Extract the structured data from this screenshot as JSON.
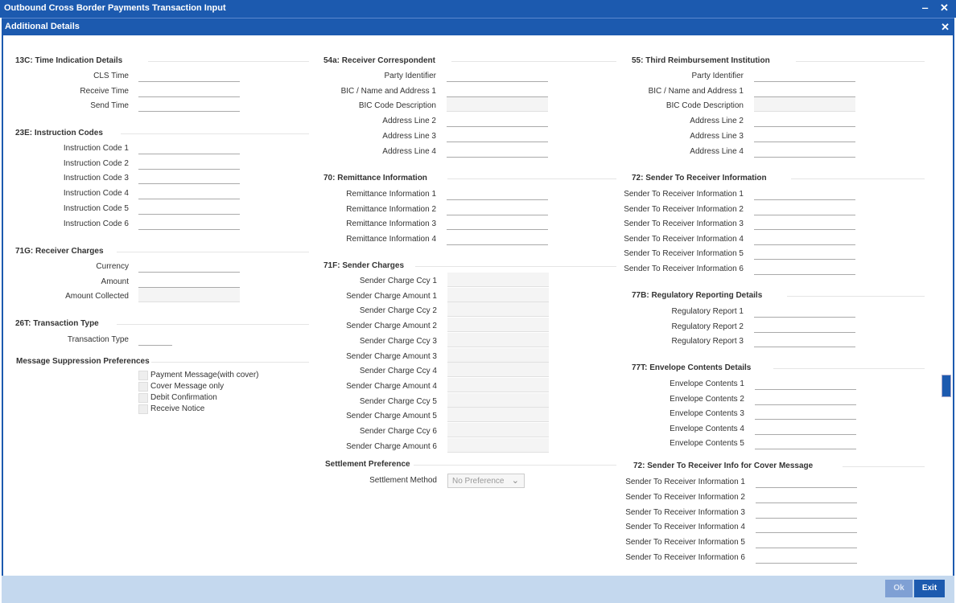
{
  "window": {
    "title": "Outbound Cross Border Payments Transaction Input",
    "minimize_glyph": "‒",
    "close_glyph": "✕"
  },
  "dialog": {
    "title": "Additional Details",
    "close_glyph": "✕"
  },
  "sections": {
    "time_indication": {
      "title": "13C: Time Indication Details",
      "labels": [
        "CLS Time",
        "Receive Time",
        "Send Time"
      ]
    },
    "instruction_codes": {
      "title": "23E: Instruction Codes",
      "labels": [
        "Instruction Code 1",
        "Instruction Code 2",
        "Instruction Code 3",
        "Instruction Code 4",
        "Instruction Code 5",
        "Instruction Code 6"
      ]
    },
    "receiver_charges": {
      "title": "71G: Receiver Charges",
      "labels": [
        "Currency",
        "Amount",
        "Amount Collected"
      ]
    },
    "transaction_type": {
      "title": "26T: Transaction Type",
      "labels": [
        "Transaction Type"
      ]
    },
    "message_suppression": {
      "title": "Message Suppression Preferences",
      "options": [
        "Payment Message(with cover)",
        "Cover Message only",
        "Debit Confirmation",
        "Receive Notice"
      ]
    },
    "receiver_correspondent": {
      "title": "54a: Receiver Correspondent",
      "labels": [
        "Party Identifier",
        "BIC / Name and Address 1",
        "BIC Code Description",
        "Address Line 2",
        "Address Line 3",
        "Address Line 4"
      ]
    },
    "remittance": {
      "title": "70: Remittance Information",
      "labels": [
        "Remittance Information 1",
        "Remittance Information 2",
        "Remittance Information 3",
        "Remittance Information 4"
      ]
    },
    "sender_charges": {
      "title": "71F: Sender Charges",
      "labels": [
        "Sender Charge Ccy 1",
        "Sender Charge Amount 1",
        "Sender Charge Ccy 2",
        "Sender Charge Amount 2",
        "Sender Charge Ccy 3",
        "Sender Charge Amount 3",
        "Sender Charge Ccy 4",
        "Sender Charge Amount 4",
        "Sender Charge Ccy 5",
        "Sender Charge Amount 5",
        "Sender Charge Ccy 6",
        "Sender Charge Amount 6"
      ]
    },
    "settlement": {
      "title": "Settlement Preference",
      "method_label": "Settlement Method",
      "method_value": "No Preference"
    },
    "third_reimbursement": {
      "title": "55: Third Reimbursement Institution",
      "labels": [
        "Party Identifier",
        "BIC / Name and Address 1",
        "BIC Code Description",
        "Address Line 2",
        "Address Line 3",
        "Address Line 4"
      ]
    },
    "sender_to_receiver": {
      "title": "72: Sender To Receiver Information",
      "labels": [
        "Sender To Receiver Information 1",
        "Sender To Receiver Information 2",
        "Sender To Receiver Information 3",
        "Sender To Receiver Information 4",
        "Sender To Receiver Information 5",
        "Sender To Receiver Information 6"
      ]
    },
    "regulatory": {
      "title": "77B: Regulatory Reporting Details",
      "labels": [
        "Regulatory Report 1",
        "Regulatory Report 2",
        "Regulatory Report 3"
      ]
    },
    "envelope": {
      "title": "77T: Envelope Contents Details",
      "labels": [
        "Envelope Contents 1",
        "Envelope Contents 2",
        "Envelope Contents 3",
        "Envelope Contents 4",
        "Envelope Contents 5"
      ]
    },
    "sender_to_receiver_cover": {
      "title": "72: Sender To Receiver Info for Cover Message",
      "labels": [
        "Sender To Receiver Information 1",
        "Sender To Receiver Information 2",
        "Sender To Receiver Information 3",
        "Sender To Receiver Information 4",
        "Sender To Receiver Information 5",
        "Sender To Receiver Information 6"
      ]
    }
  },
  "footer": {
    "ok_label": "Ok",
    "exit_label": "Exit"
  }
}
